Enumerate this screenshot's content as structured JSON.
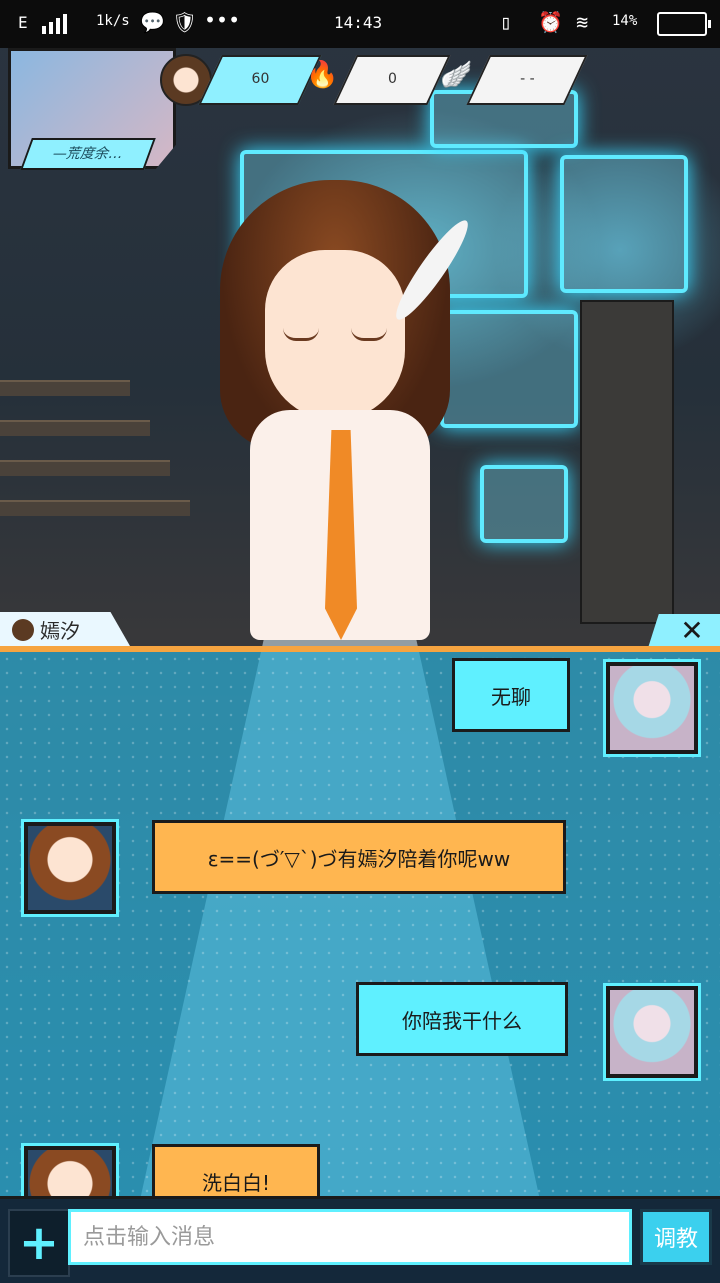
{
  "status_bar": {
    "network": "E",
    "speed": "1k/s",
    "time": "14:43",
    "battery": "14%"
  },
  "hud": {
    "profile_name": "—荒度余…",
    "affection": "60",
    "energy": "0",
    "wings": "- -"
  },
  "character": {
    "name": "嫣汐"
  },
  "chat": {
    "messages": [
      {
        "from": "user",
        "text": "无聊"
      },
      {
        "from": "bot",
        "text": "ε==(づ′▽`)づ有嫣汐陪着你呢ww"
      },
      {
        "from": "user",
        "text": "你陪我干什么"
      },
      {
        "from": "bot",
        "text": "洗白白!"
      }
    ]
  },
  "input": {
    "placeholder": "点击输入消息",
    "send_label": "调教"
  },
  "icons": {
    "plus": "plus-icon",
    "close": "close-icon",
    "fire": "fire-icon",
    "wing": "wing-icon"
  },
  "colors": {
    "accent_cyan": "#5ff0ff",
    "bot_bubble": "#ffb650",
    "orange_line": "#f6a440"
  }
}
